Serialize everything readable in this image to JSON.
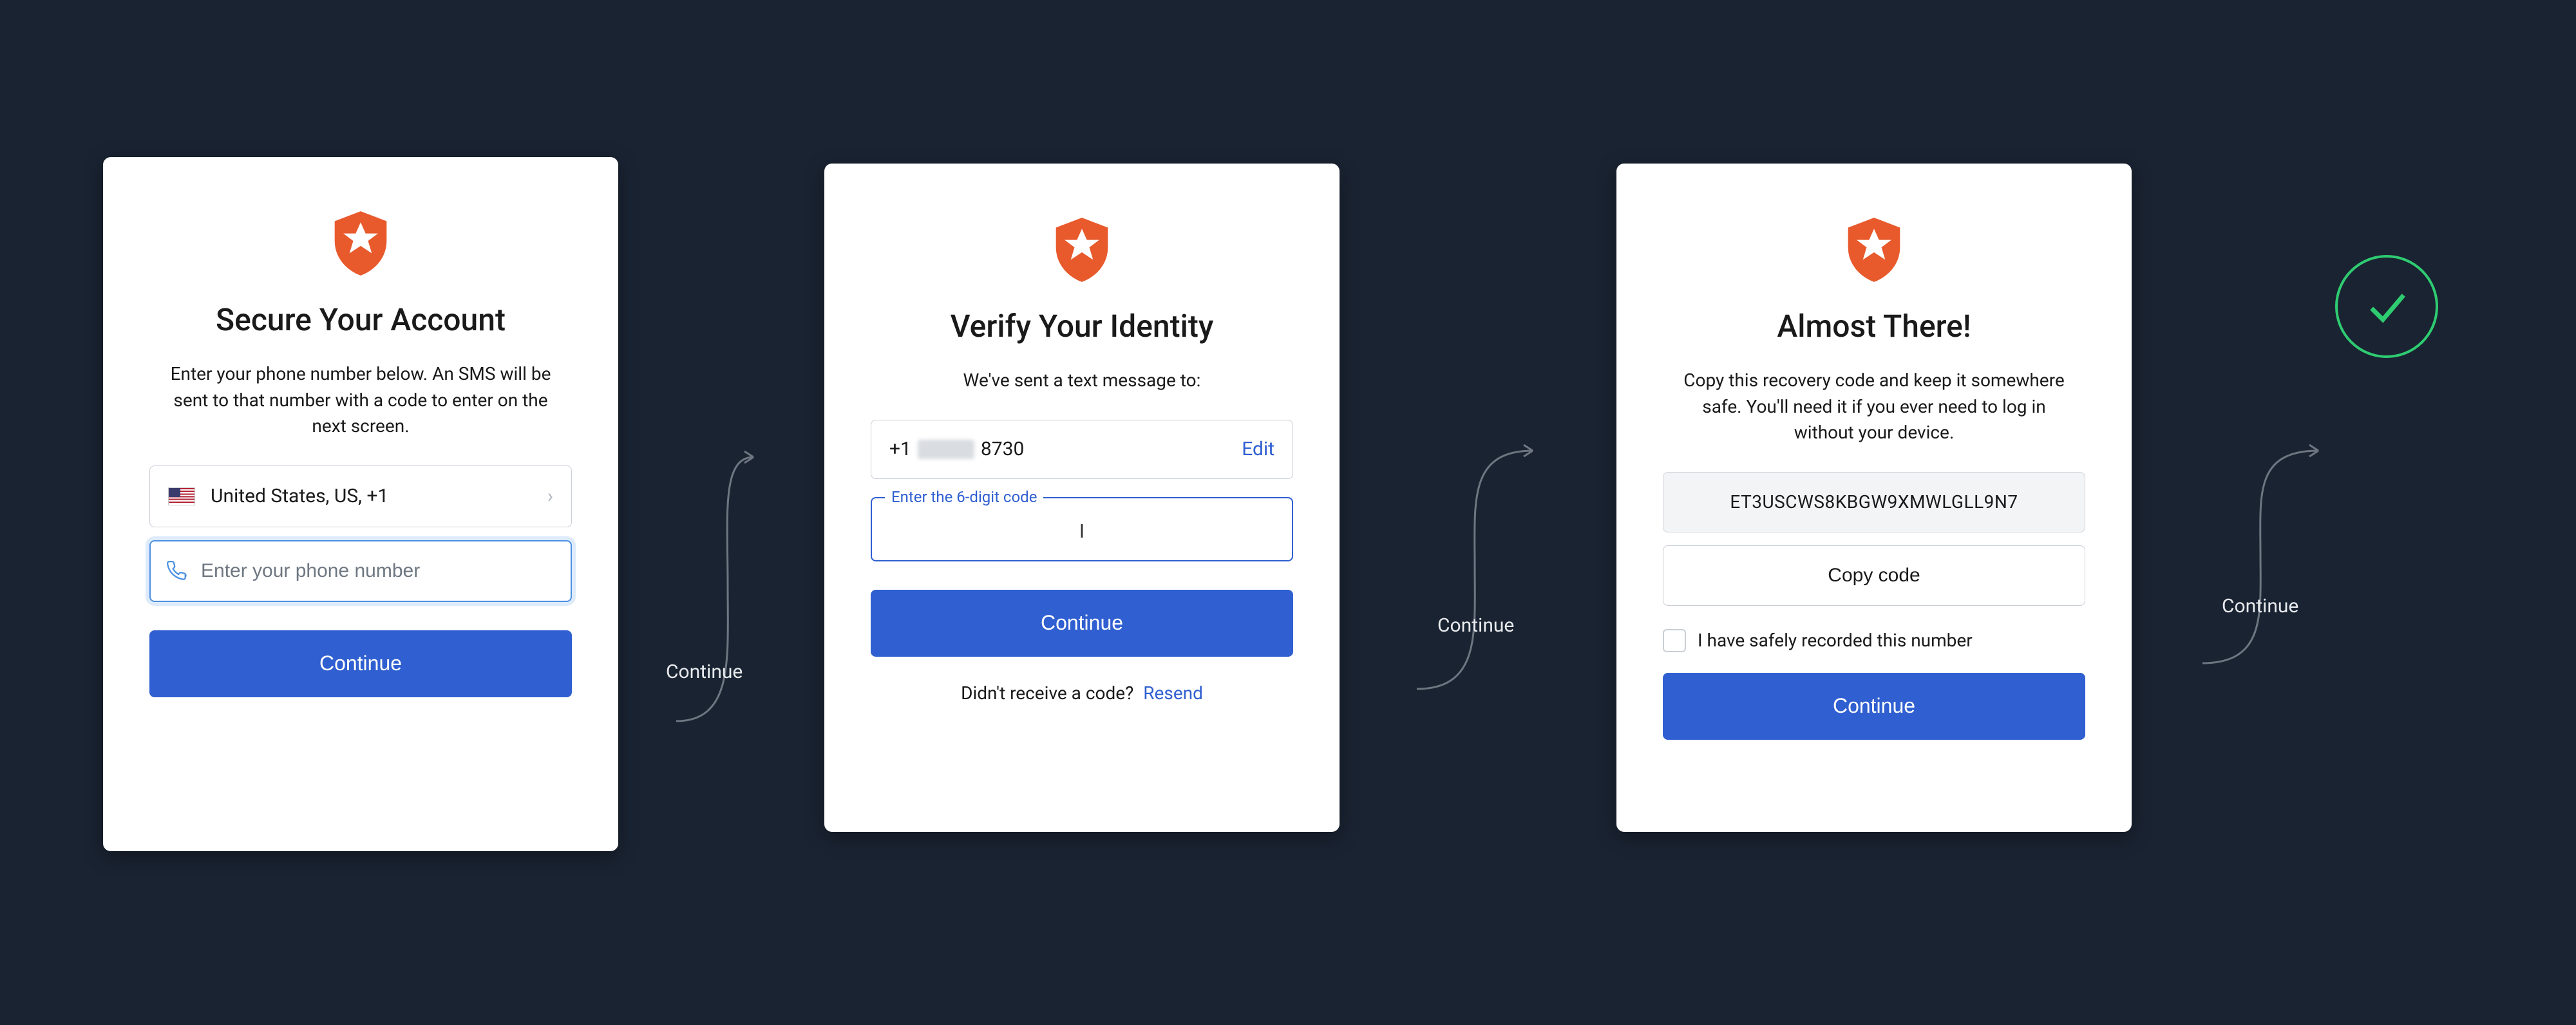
{
  "flow_labels": [
    "Continue",
    "Continue",
    "Continue"
  ],
  "card1": {
    "title": "Secure Your Account",
    "subtitle": "Enter your phone number below. An SMS will be sent to that number with a code to enter on the next screen.",
    "country_label": "United States, US, +1",
    "phone_placeholder": "Enter your phone number",
    "continue_label": "Continue"
  },
  "card2": {
    "title": "Verify Your Identity",
    "subtitle": "We've sent a text message to:",
    "phone_prefix": "+1",
    "phone_masked_suffix": "8730",
    "edit_label": "Edit",
    "code_label": "Enter the 6-digit code",
    "continue_label": "Continue",
    "resend_prompt": "Didn't receive a code?",
    "resend_label": "Resend"
  },
  "card3": {
    "title": "Almost There!",
    "subtitle": "Copy this recovery code and keep it somewhere safe. You'll need it if you ever need to log in without your device.",
    "recovery_code": "ET3USCWS8KBGW9XMWLGLL9N7",
    "copy_label": "Copy code",
    "checkbox_label": "I have safely recorded this number",
    "continue_label": "Continue"
  },
  "colors": {
    "accent": "#2f5fd0",
    "logo": "#e85a2c",
    "success": "#2ecc71",
    "background": "#1a2332"
  }
}
